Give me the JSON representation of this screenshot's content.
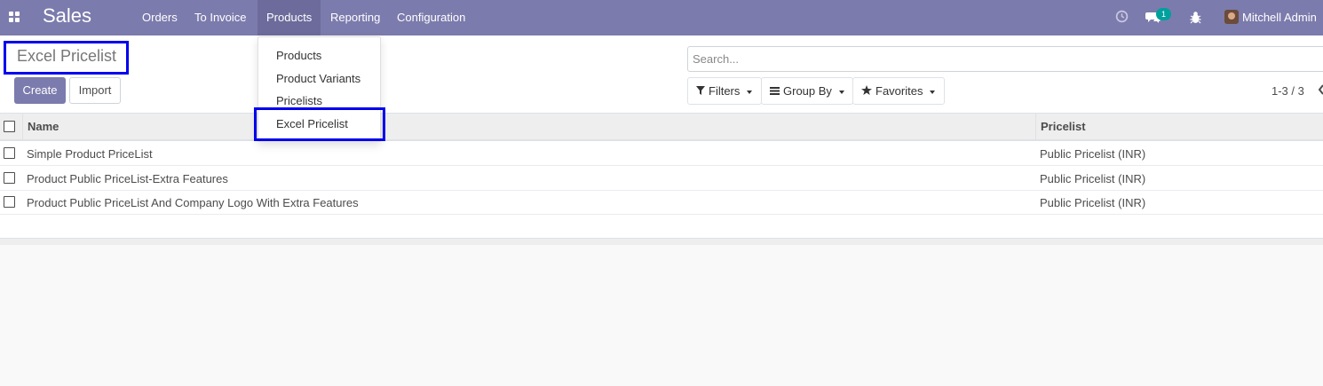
{
  "navbar": {
    "app_title": "Sales",
    "menu": [
      "Orders",
      "To Invoice",
      "Products",
      "Reporting",
      "Configuration"
    ],
    "active_menu": "Products",
    "messages_badge": "1",
    "user_name": "Mitchell Admin",
    "bg_color": "#7c7bad"
  },
  "breadcrumb": {
    "title": "Excel Pricelist"
  },
  "buttons": {
    "create": "Create",
    "import": "Import"
  },
  "search": {
    "placeholder": "Search...",
    "value": ""
  },
  "filters": {
    "filters_label": "Filters",
    "group_by_label": "Group By",
    "favorites_label": "Favorites"
  },
  "pager": {
    "text": "1-3 / 3"
  },
  "table": {
    "columns": [
      "Name",
      "Pricelist"
    ],
    "rows": [
      {
        "name": "Simple Product PriceList",
        "pricelist": "Public Pricelist (INR)"
      },
      {
        "name": "Product Public PriceList-Extra Features",
        "pricelist": "Public Pricelist (INR)"
      },
      {
        "name": "Product Public PriceList And Company Logo With Extra Features",
        "pricelist": "Public Pricelist (INR)"
      }
    ]
  },
  "products_dropdown": {
    "items": [
      "Products",
      "Product Variants",
      "Pricelists",
      "Excel Pricelist"
    ],
    "highlighted": "Excel Pricelist"
  },
  "icons": [
    "apps-grid-icon",
    "clock-icon",
    "chat-icon",
    "bug-icon",
    "filter-icon",
    "bars-icon",
    "star-icon",
    "chevron-left-icon"
  ],
  "colors": {
    "accent": "#7c7bad",
    "annotation": "#0000ee",
    "badge": "#00a09d"
  }
}
